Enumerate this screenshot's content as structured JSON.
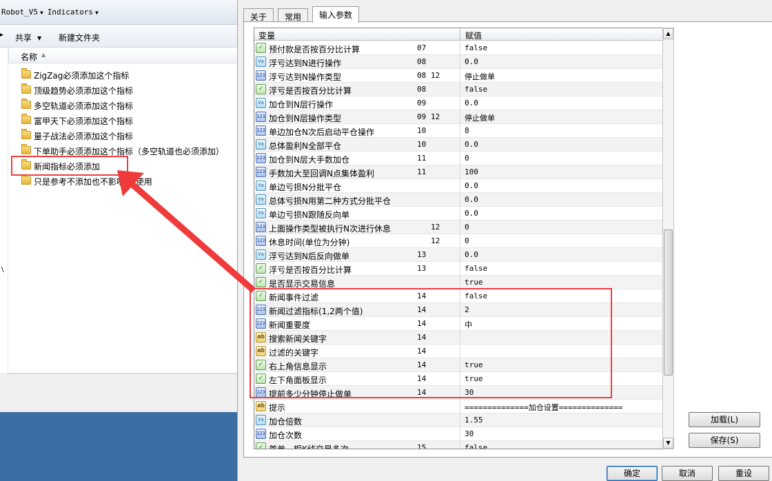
{
  "explorer": {
    "address": {
      "segments": [
        "Robot_V5",
        "Indicators"
      ]
    },
    "toolbar": {
      "share_label": "共享",
      "new_folder_label": "新建文件夹"
    },
    "column_header": "名称",
    "items": [
      {
        "name": "ZigZag必须添加这个指标"
      },
      {
        "name": "顶级趋势必须添加这个指标"
      },
      {
        "name": "多空轨道必须添加这个指标"
      },
      {
        "name": "富甲天下必须添加这个指标"
      },
      {
        "name": "量子战法必须添加这个指标"
      },
      {
        "name": "下单助手必须添加这个指标（多空轨道也必须添加）"
      },
      {
        "name": "新闻指标必须添加"
      },
      {
        "name": "只是参考不添加也不影响EA使用"
      }
    ],
    "highlighted_item": "新闻指标必须添加",
    "desktop_color": "#3a6ea5"
  },
  "annotation": {
    "color": "#ef3b3b"
  },
  "dialog": {
    "tabs": [
      {
        "label": "关于",
        "active": false
      },
      {
        "label": "常用",
        "active": false
      },
      {
        "label": "输入参数",
        "active": true
      }
    ],
    "grid": {
      "columns": {
        "variable": "变量",
        "value": "赋值"
      },
      "rows": [
        {
          "type": "bool",
          "name": "预付款是否按百分比计算",
          "ref": "07",
          "value": "false"
        },
        {
          "type": "double",
          "name": "浮亏达到N进行操作",
          "ref": "08",
          "value": "0.0"
        },
        {
          "type": "int",
          "name": "浮亏达到N操作类型",
          "ref": "08 12",
          "value": "停止做单"
        },
        {
          "type": "bool",
          "name": "浮亏是否按百分比计算",
          "ref": "08",
          "value": "false"
        },
        {
          "type": "double",
          "name": "加仓到N层行操作",
          "ref": "09",
          "value": "0.0"
        },
        {
          "type": "int",
          "name": "加仓到N层操作类型",
          "ref": "09 12",
          "value": "停止做单"
        },
        {
          "type": "int",
          "name": "单边加仓N次后启动平仓操作",
          "ref": "10",
          "value": "8"
        },
        {
          "type": "double",
          "name": "总体盈利N全部平仓",
          "ref": "10",
          "value": "0.0"
        },
        {
          "type": "int",
          "name": "加仓到N层大手数加仓",
          "ref": "11",
          "value": "0"
        },
        {
          "type": "int",
          "name": "手数加大至回调N点集体盈利",
          "ref": "11",
          "value": "100"
        },
        {
          "type": "double",
          "name": "单边亏损N分批平仓",
          "ref": "",
          "value": "0.0"
        },
        {
          "type": "double",
          "name": "总体亏损N用第二种方式分批平仓",
          "ref": "",
          "value": "0.0"
        },
        {
          "type": "double",
          "name": "单边亏损N跟随反向单",
          "ref": "",
          "value": "0.0"
        },
        {
          "type": "int",
          "name": "上面操作类型被执行N次进行休息",
          "ref": "12",
          "value": "0"
        },
        {
          "type": "int",
          "name": "休息时间(单位为分钟)",
          "ref": "12",
          "value": "0"
        },
        {
          "type": "double",
          "name": "浮亏达到N后反向做单",
          "ref": "13",
          "value": "0.0"
        },
        {
          "type": "bool",
          "name": "浮亏是否按百分比计算",
          "ref": "13",
          "value": "false"
        },
        {
          "type": "bool",
          "name": "是否显示交易信息",
          "ref": "",
          "value": "true"
        },
        {
          "type": "bool",
          "name": "新闻事件过滤",
          "ref": "14",
          "value": "false"
        },
        {
          "type": "int",
          "name": "新闻过滤指标(1,2两个值)",
          "ref": "14",
          "value": "2"
        },
        {
          "type": "int",
          "name": "新闻重要度",
          "ref": "14",
          "value": "中"
        },
        {
          "type": "string",
          "name": "搜索新闻关键字",
          "ref": "14",
          "value": ""
        },
        {
          "type": "string",
          "name": "过滤的关键字",
          "ref": "14",
          "value": ""
        },
        {
          "type": "bool",
          "name": "右上角信息显示",
          "ref": "14",
          "value": "true"
        },
        {
          "type": "bool",
          "name": "左下角面板显示",
          "ref": "14",
          "value": "true"
        },
        {
          "type": "int",
          "name": "提前多少分钟停止做单",
          "ref": "14",
          "value": "30"
        },
        {
          "type": "string",
          "name": "提示",
          "ref": "",
          "value": "==============加仓设置=============="
        },
        {
          "type": "double",
          "name": "加仓倍数",
          "ref": "",
          "value": "1.55"
        },
        {
          "type": "int",
          "name": "加仓次数",
          "ref": "",
          "value": "30"
        },
        {
          "type": "bool",
          "name": "首单一根K线交易多次",
          "ref": "15",
          "value": "false"
        }
      ]
    },
    "side_buttons": {
      "load": "加载(L)",
      "save": "保存(S)"
    },
    "bottom_buttons": {
      "ok": "确定",
      "cancel": "取消",
      "reset": "重设"
    }
  }
}
